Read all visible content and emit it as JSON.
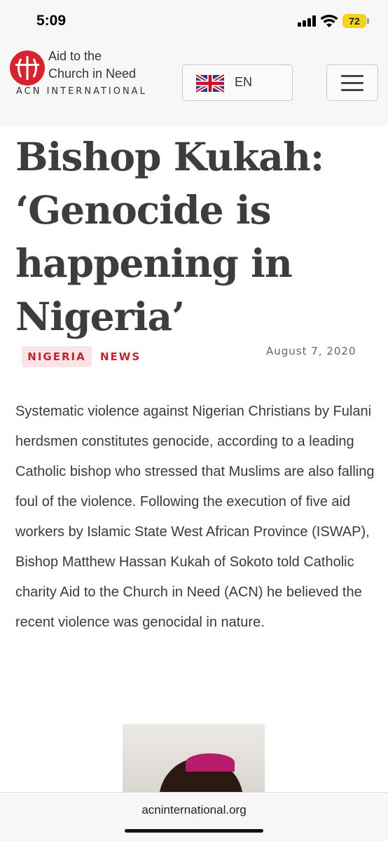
{
  "status_bar": {
    "time": "5:09",
    "battery": "72"
  },
  "header": {
    "logo_line1": "Aid to the",
    "logo_line2": "Church in Need",
    "logo_sub": "ACN INTERNATIONAL",
    "language": "EN",
    "colors": {
      "brand_red": "#d8222f",
      "background": "#f7f7f7"
    }
  },
  "article": {
    "title": "Bishop Kukah: ‘Genocide is happening in Nigeria’",
    "tags": [
      "NIGERIA",
      "NEWS"
    ],
    "date": "August 7, 2020",
    "body": "Systematic violence against Nigerian Christians by Fulani herdsmen constitutes genocide, according to a leading Catholic bishop who stressed that Muslims are also falling foul of the violence. Following the execution of five aid workers by Islamic State West African Province (ISWAP), Bishop Matthew Hassan Kukah of Sokoto told Catholic charity Aid to the Church in Need (ACN) he believed the recent violence was genocidal in nature.",
    "tag_color": "#c0272d"
  },
  "browser": {
    "url": "acninternational.org"
  }
}
